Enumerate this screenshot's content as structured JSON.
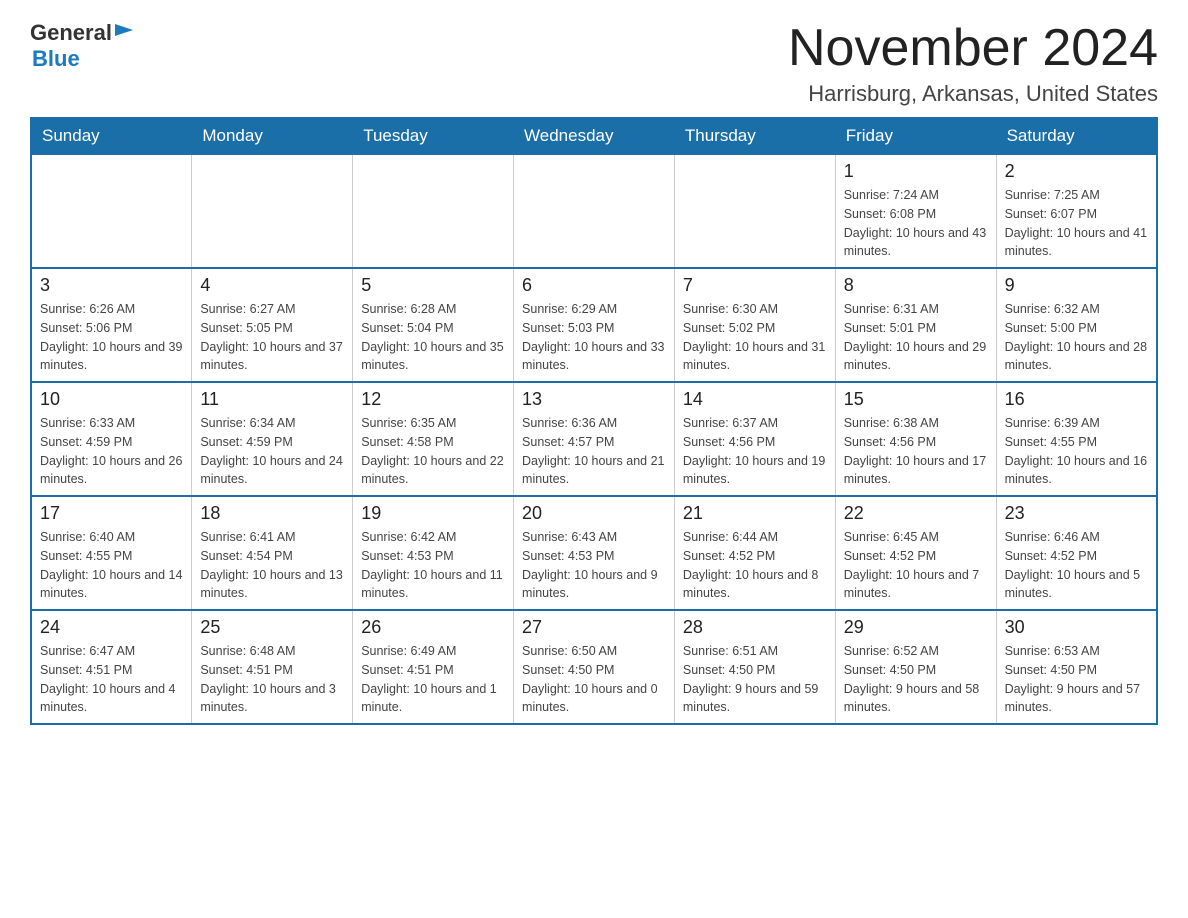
{
  "header": {
    "logo": {
      "general": "General",
      "blue": "Blue"
    },
    "title": "November 2024",
    "location": "Harrisburg, Arkansas, United States"
  },
  "weekdays": [
    "Sunday",
    "Monday",
    "Tuesday",
    "Wednesday",
    "Thursday",
    "Friday",
    "Saturday"
  ],
  "weeks": [
    [
      {
        "day": "",
        "info": ""
      },
      {
        "day": "",
        "info": ""
      },
      {
        "day": "",
        "info": ""
      },
      {
        "day": "",
        "info": ""
      },
      {
        "day": "",
        "info": ""
      },
      {
        "day": "1",
        "info": "Sunrise: 7:24 AM\nSunset: 6:08 PM\nDaylight: 10 hours and 43 minutes."
      },
      {
        "day": "2",
        "info": "Sunrise: 7:25 AM\nSunset: 6:07 PM\nDaylight: 10 hours and 41 minutes."
      }
    ],
    [
      {
        "day": "3",
        "info": "Sunrise: 6:26 AM\nSunset: 5:06 PM\nDaylight: 10 hours and 39 minutes."
      },
      {
        "day": "4",
        "info": "Sunrise: 6:27 AM\nSunset: 5:05 PM\nDaylight: 10 hours and 37 minutes."
      },
      {
        "day": "5",
        "info": "Sunrise: 6:28 AM\nSunset: 5:04 PM\nDaylight: 10 hours and 35 minutes."
      },
      {
        "day": "6",
        "info": "Sunrise: 6:29 AM\nSunset: 5:03 PM\nDaylight: 10 hours and 33 minutes."
      },
      {
        "day": "7",
        "info": "Sunrise: 6:30 AM\nSunset: 5:02 PM\nDaylight: 10 hours and 31 minutes."
      },
      {
        "day": "8",
        "info": "Sunrise: 6:31 AM\nSunset: 5:01 PM\nDaylight: 10 hours and 29 minutes."
      },
      {
        "day": "9",
        "info": "Sunrise: 6:32 AM\nSunset: 5:00 PM\nDaylight: 10 hours and 28 minutes."
      }
    ],
    [
      {
        "day": "10",
        "info": "Sunrise: 6:33 AM\nSunset: 4:59 PM\nDaylight: 10 hours and 26 minutes."
      },
      {
        "day": "11",
        "info": "Sunrise: 6:34 AM\nSunset: 4:59 PM\nDaylight: 10 hours and 24 minutes."
      },
      {
        "day": "12",
        "info": "Sunrise: 6:35 AM\nSunset: 4:58 PM\nDaylight: 10 hours and 22 minutes."
      },
      {
        "day": "13",
        "info": "Sunrise: 6:36 AM\nSunset: 4:57 PM\nDaylight: 10 hours and 21 minutes."
      },
      {
        "day": "14",
        "info": "Sunrise: 6:37 AM\nSunset: 4:56 PM\nDaylight: 10 hours and 19 minutes."
      },
      {
        "day": "15",
        "info": "Sunrise: 6:38 AM\nSunset: 4:56 PM\nDaylight: 10 hours and 17 minutes."
      },
      {
        "day": "16",
        "info": "Sunrise: 6:39 AM\nSunset: 4:55 PM\nDaylight: 10 hours and 16 minutes."
      }
    ],
    [
      {
        "day": "17",
        "info": "Sunrise: 6:40 AM\nSunset: 4:55 PM\nDaylight: 10 hours and 14 minutes."
      },
      {
        "day": "18",
        "info": "Sunrise: 6:41 AM\nSunset: 4:54 PM\nDaylight: 10 hours and 13 minutes."
      },
      {
        "day": "19",
        "info": "Sunrise: 6:42 AM\nSunset: 4:53 PM\nDaylight: 10 hours and 11 minutes."
      },
      {
        "day": "20",
        "info": "Sunrise: 6:43 AM\nSunset: 4:53 PM\nDaylight: 10 hours and 9 minutes."
      },
      {
        "day": "21",
        "info": "Sunrise: 6:44 AM\nSunset: 4:52 PM\nDaylight: 10 hours and 8 minutes."
      },
      {
        "day": "22",
        "info": "Sunrise: 6:45 AM\nSunset: 4:52 PM\nDaylight: 10 hours and 7 minutes."
      },
      {
        "day": "23",
        "info": "Sunrise: 6:46 AM\nSunset: 4:52 PM\nDaylight: 10 hours and 5 minutes."
      }
    ],
    [
      {
        "day": "24",
        "info": "Sunrise: 6:47 AM\nSunset: 4:51 PM\nDaylight: 10 hours and 4 minutes."
      },
      {
        "day": "25",
        "info": "Sunrise: 6:48 AM\nSunset: 4:51 PM\nDaylight: 10 hours and 3 minutes."
      },
      {
        "day": "26",
        "info": "Sunrise: 6:49 AM\nSunset: 4:51 PM\nDaylight: 10 hours and 1 minute."
      },
      {
        "day": "27",
        "info": "Sunrise: 6:50 AM\nSunset: 4:50 PM\nDaylight: 10 hours and 0 minutes."
      },
      {
        "day": "28",
        "info": "Sunrise: 6:51 AM\nSunset: 4:50 PM\nDaylight: 9 hours and 59 minutes."
      },
      {
        "day": "29",
        "info": "Sunrise: 6:52 AM\nSunset: 4:50 PM\nDaylight: 9 hours and 58 minutes."
      },
      {
        "day": "30",
        "info": "Sunrise: 6:53 AM\nSunset: 4:50 PM\nDaylight: 9 hours and 57 minutes."
      }
    ]
  ]
}
